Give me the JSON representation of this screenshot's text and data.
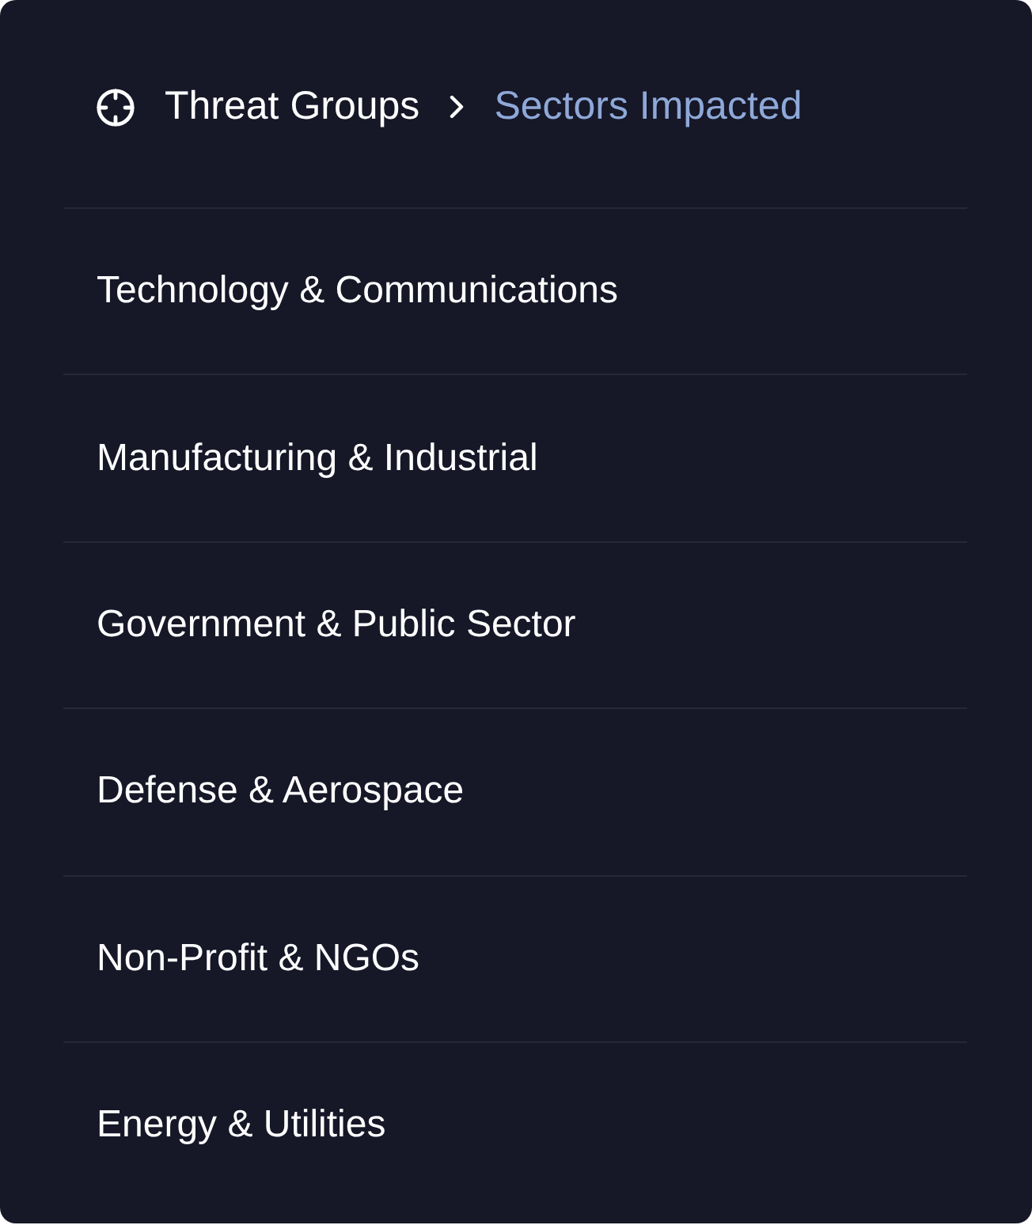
{
  "breadcrumb": {
    "items": [
      {
        "label": "Threat Groups",
        "selected": false
      },
      {
        "label": "Sectors Impacted",
        "selected": true
      }
    ]
  },
  "sectors": [
    {
      "label": "Technology & Communications"
    },
    {
      "label": "Manufacturing & Industrial"
    },
    {
      "label": "Government & Public Sector"
    },
    {
      "label": "Defense & Aerospace"
    },
    {
      "label": "Non-Profit & NGOs"
    },
    {
      "label": "Energy & Utilities"
    }
  ]
}
